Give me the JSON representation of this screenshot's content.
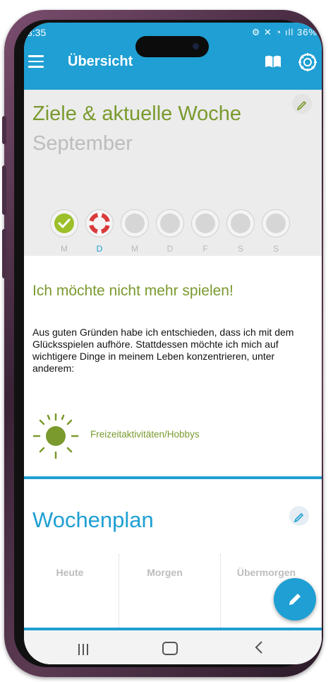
{
  "status": {
    "time": "3:35",
    "battery": "36%"
  },
  "appbar": {
    "title": "Übersicht"
  },
  "goals": {
    "title": "Ziele & aktuelle Woche",
    "month": "September",
    "days": [
      {
        "label": "M",
        "state": "success"
      },
      {
        "label": "D",
        "state": "help",
        "active": true
      },
      {
        "label": "M",
        "state": "empty"
      },
      {
        "label": "D",
        "state": "empty"
      },
      {
        "label": "F",
        "state": "empty"
      },
      {
        "label": "S",
        "state": "empty"
      },
      {
        "label": "S",
        "state": "empty"
      }
    ]
  },
  "statement": {
    "heading": "Ich möchte nicht mehr spielen!",
    "body": "Aus guten Gründen habe ich entschieden, dass ich mit dem Glücksspielen aufhöre. Stattdessen möchte ich mich auf wichtigere Dinge in meinem Leben konzentrieren, unter anderem:",
    "hobby": "Freizeitaktivitäten/Hobbys"
  },
  "weekplan": {
    "title": "Wochenplan",
    "columns": [
      "Heute",
      "Morgen",
      "Übermorgen"
    ]
  },
  "colors": {
    "primary": "#1f9fd3",
    "green": "#7a9a2e",
    "red": "#d93b3b",
    "check": "#9cbf2a"
  }
}
